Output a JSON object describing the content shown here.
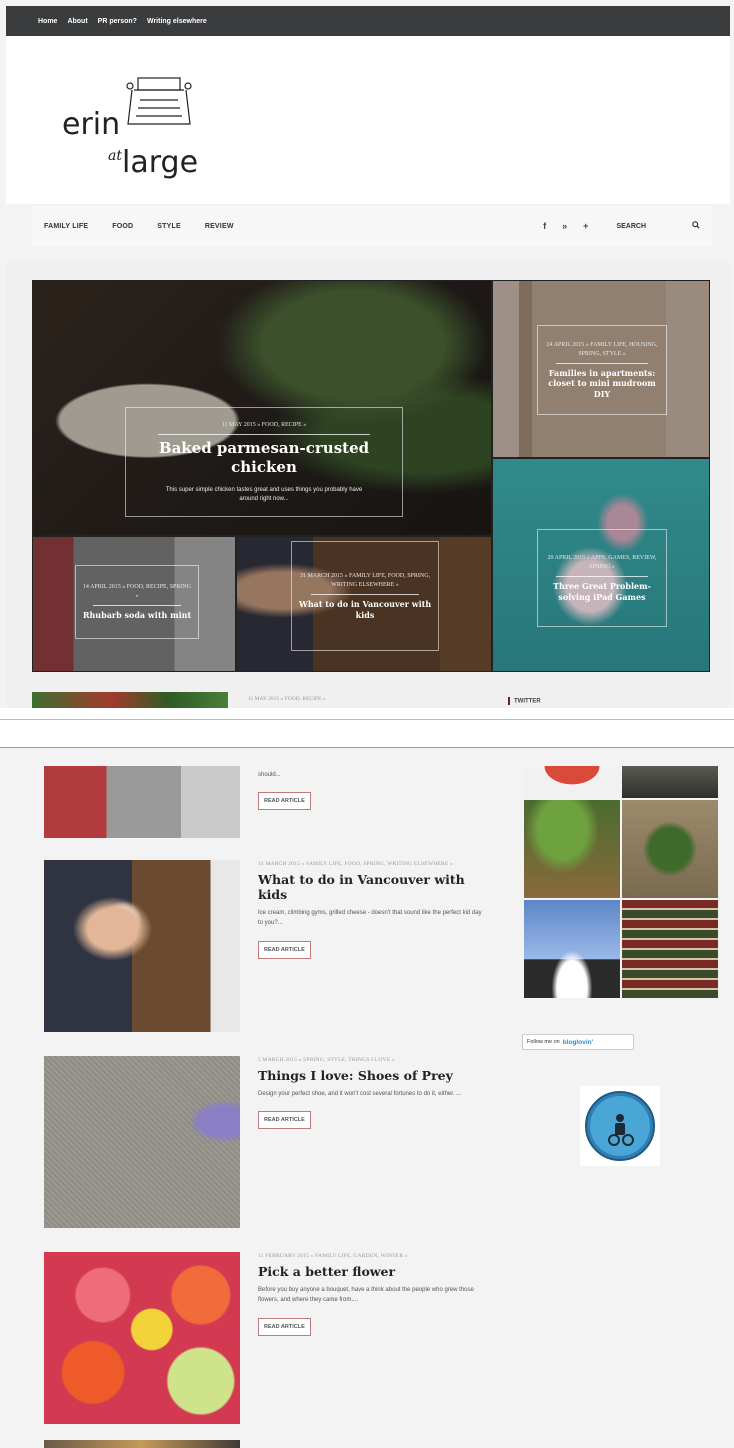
{
  "top_nav": {
    "items": [
      "Home",
      "About",
      "PR person?",
      "Writing elsewhere"
    ]
  },
  "logo": {
    "line1": "erin",
    "line2": "at",
    "line3": "large"
  },
  "category_nav": {
    "items": [
      "FAMILY LIFE",
      "FOOD",
      "STYLE",
      "REVIEW"
    ],
    "social": {
      "facebook": "f",
      "twitter": "»",
      "plus": "+"
    },
    "search_label": "SEARCH",
    "search_icon": "search-icon"
  },
  "featured": {
    "main": {
      "meta": "11 MAY 2015 » FOOD, RECIPE »",
      "title": "Baked parmesan-crusted chicken",
      "excerpt": "This super simple chicken tastes great and uses things you probably have around right now..."
    },
    "right_top": {
      "meta": "24 APRIL 2015 » FAMILY LIFE, HOUSING, SPRING, STYLE »",
      "title": "Families in apartments: closet to mini mudroom DIY"
    },
    "right_bottom": {
      "meta": "20 APRIL 2015 » APPS, GAMES, REVIEW, SPRING »",
      "title": "Three Great Problem-solving iPad Games"
    },
    "bottom_left": {
      "meta": "14 APRIL 2015 » FOOD, RECIPE, SPRING »",
      "title": "Rhubarb soda with mint"
    },
    "bottom_mid": {
      "meta": "31 MARCH 2015 » FAMILY LIFE, FOOD, SPRING, WRITING ELSEWHERE »",
      "title": "What to do in Vancouver with kids"
    }
  },
  "posts": [
    {
      "meta": "11 MAY 2015 » FOOD, RECIPE »",
      "title": "",
      "excerpt": "should...",
      "button": "READ ARTICLE"
    },
    {
      "meta": "31 MARCH 2015 » FAMILY LIFE, FOOD, SPRING, WRITING ELSEWHERE »",
      "title": "What to do in Vancouver with kids",
      "excerpt": "Ice cream, climbing gyms, grilled cheese - doesn't that sound like the perfect kid day to you?...",
      "button": "READ ARTICLE"
    },
    {
      "meta": "5 MARCH 2015 » SPRING, STYLE, THINGS I LOVE »",
      "title": "Things I love: Shoes of Prey",
      "excerpt": "Design your perfect shoe, and it won't cost several fortunes to do it, either. ...",
      "button": "READ ARTICLE"
    },
    {
      "meta": "11 FEBRUARY 2015 » FAMILY LIFE, GARDEN, WINTER »",
      "title": "Pick a better flower",
      "excerpt": "Before you buy anyone a bouquet, have a think about the people who grew those flowers, and where they came from....",
      "button": "READ ARTICLE"
    }
  ],
  "sidebar": {
    "twitter_label": "TWITTER",
    "bloglovin_prefix": "Follow me on",
    "bloglovin_brand": "bloglovin'"
  },
  "colors": {
    "topbar": "#3a3c3e",
    "accent": "#7a1c1c",
    "button_border": "#c07a7a"
  }
}
